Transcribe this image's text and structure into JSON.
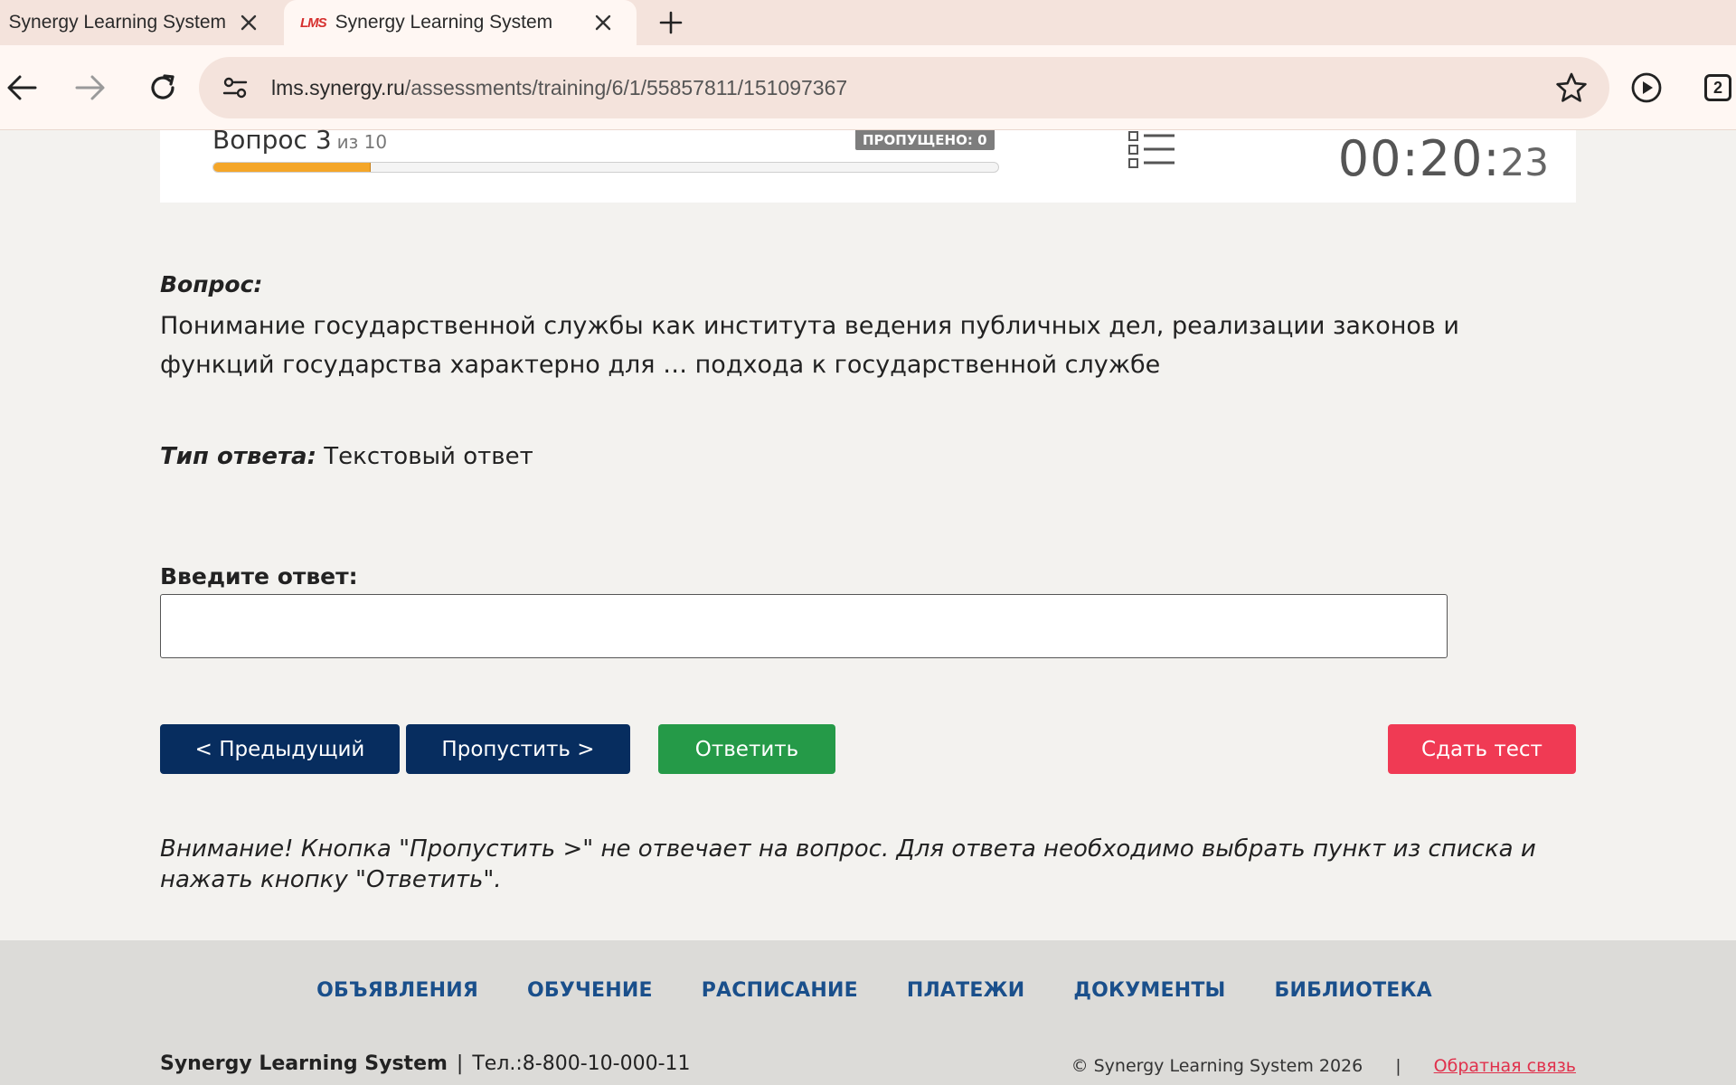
{
  "browser": {
    "tabs": [
      {
        "title": "Synergy Learning System",
        "active": false
      },
      {
        "title": "Synergy Learning System",
        "active": true,
        "favicon_text": "LMS"
      }
    ],
    "url_host": "lms.synergy.ru",
    "url_path": "/assessments/training/6/1/55857811/151097367",
    "tab_count": "2",
    "icons": [
      "back-icon",
      "forward-icon",
      "reload-icon",
      "site-settings-icon",
      "star-icon",
      "media-play-icon",
      "tab-count-icon",
      "close-icon",
      "plus-icon"
    ]
  },
  "header": {
    "question_label": "Вопрос 3",
    "question_of": "из 10",
    "skipped_label": "ПРОПУЩЕНО: 0",
    "progress_fraction": 0.2,
    "timer_main": "00:20:",
    "timer_seconds": "23"
  },
  "question": {
    "title": "Вопрос:",
    "text": "Понимание государственной службы как института ведения публичных дел, реализации законов и функций государства характерно для … подхода к государственной службе",
    "answer_type_label": "Тип ответа:",
    "answer_type_value": "Текстовый ответ",
    "answer_label": "Введите ответ:",
    "answer_value": ""
  },
  "buttons": {
    "prev": "< Предыдущий",
    "skip": "Пропустить >",
    "answer": "Ответить",
    "submit": "Сдать тест"
  },
  "warning": "Внимание! Кнопка \"Пропустить >\" не отвечает на вопрос. Для ответа необходимо выбрать пункт из списка и нажать кнопку \"Ответить\".",
  "footer": {
    "nav": [
      "ОБЪЯВЛЕНИЯ",
      "ОБУЧЕНИЕ",
      "РАСПИСАНИЕ",
      "ПЛАТЕЖИ",
      "ДОКУМЕНТЫ",
      "БИБЛИОТЕКА"
    ],
    "brand": "Synergy Learning System",
    "separator": "|",
    "phone": "Тел.:8-800-10-000-11",
    "copyright": "© Synergy Learning System 2026",
    "feedback": "Обратная связь"
  },
  "colors": {
    "progress": "#f4a629",
    "nav_button": "#072d5f",
    "answer_button": "#259a48",
    "submit_button": "#f03a54",
    "footer_link": "#1a4f8b",
    "feedback_link": "#e0304b"
  }
}
